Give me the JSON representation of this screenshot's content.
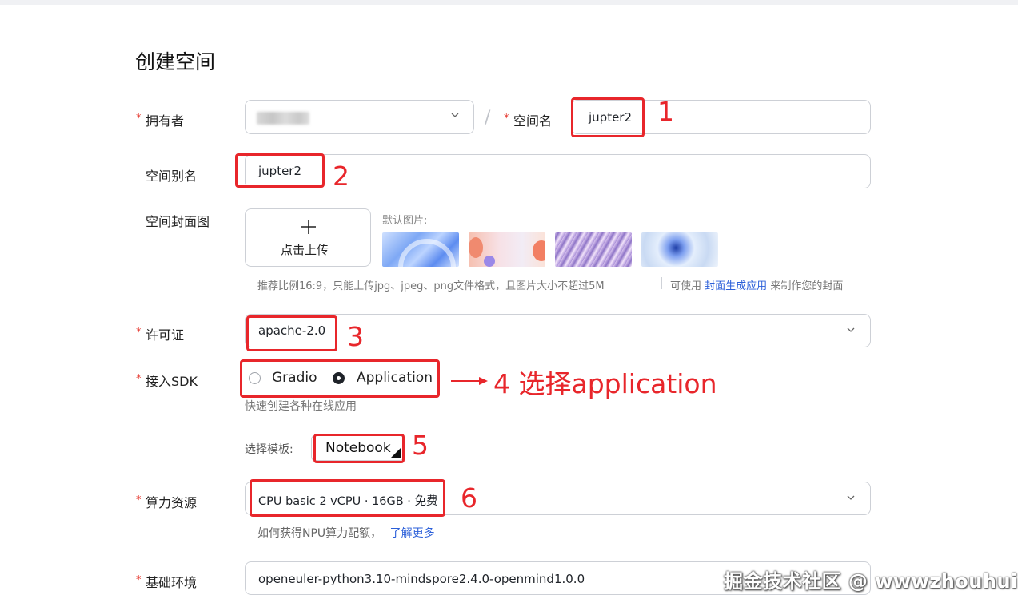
{
  "page": {
    "title": "创建空间",
    "required_mark": "*"
  },
  "owner": {
    "label": "拥有者",
    "value": "",
    "separator": "/"
  },
  "space_name": {
    "label": "空间名",
    "value": "jupter2"
  },
  "space_alias": {
    "label": "空间别名",
    "value": "jupter2"
  },
  "cover": {
    "label": "空间封面图",
    "upload_icon": "plus-icon",
    "upload_label": "点击上传",
    "defaults_label": "默认图片:",
    "hint": "推荐比例16:9，只能上传jpg、jpeg、png文件格式，且图片大小不超过5M",
    "hint2_prefix": "可使用",
    "hint2_link": "封面生成应用",
    "hint2_suffix": "来制作您的封面"
  },
  "license": {
    "label": "许可证",
    "value": "apache-2.0"
  },
  "sdk": {
    "label": "接入SDK",
    "options": [
      {
        "label": "Gradio",
        "selected": false
      },
      {
        "label": "Application",
        "selected": true
      }
    ],
    "hint": "快速创建各种在线应用"
  },
  "template": {
    "label": "选择模板:",
    "value": "Notebook"
  },
  "compute": {
    "label": "算力资源",
    "value": "CPU basic 2 vCPU · 16GB · 免费",
    "hint": "如何获得NPU算力配额，",
    "hint_link": "了解更多"
  },
  "base_env": {
    "label": "基础环境",
    "value": "openeuler-python3.10-mindspore2.4.0-openmind1.0.0"
  },
  "annotations": {
    "n1": "1",
    "n2": "2",
    "n3": "3",
    "n4": "4 选择application",
    "n5": "5",
    "n6": "6",
    "arrow_color": "#e8262b"
  },
  "watermark": "掘金技术社区 @ wwwzhouhui",
  "colors": {
    "accent_red": "#e8262b",
    "link_blue": "#2b5fd9",
    "required_red": "#e5342b"
  }
}
